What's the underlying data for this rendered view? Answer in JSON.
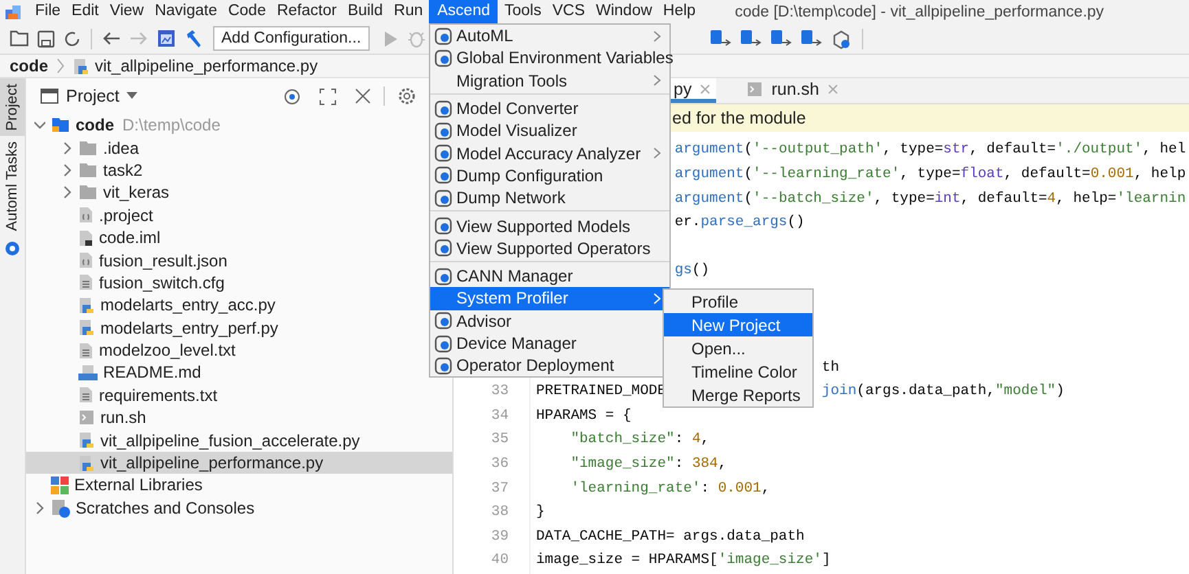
{
  "menubar": {
    "items": [
      {
        "label": "File",
        "selected": false
      },
      {
        "label": "Edit",
        "selected": false
      },
      {
        "label": "View",
        "selected": false
      },
      {
        "label": "Navigate",
        "selected": false
      },
      {
        "label": "Code",
        "selected": false
      },
      {
        "label": "Refactor",
        "selected": false
      },
      {
        "label": "Build",
        "selected": false
      },
      {
        "label": "Run",
        "selected": false
      },
      {
        "label": "Ascend",
        "selected": true
      },
      {
        "label": "Tools",
        "selected": false
      },
      {
        "label": "VCS",
        "selected": false
      },
      {
        "label": "Window",
        "selected": false
      },
      {
        "label": "Help",
        "selected": false
      }
    ]
  },
  "window_title": "code [D:\\temp\\code] - vit_allpipeline_performance.py",
  "toolbar": {
    "run_configuration": "Add Configuration..."
  },
  "breadcrumb": [
    "code",
    "vit_allpipeline_performance.py"
  ],
  "tool_strip": [
    {
      "label": "Project",
      "selected": true
    },
    {
      "label": "Automl Tasks",
      "selected": false
    }
  ],
  "project_panel": {
    "title": "Project",
    "tree": [
      {
        "name": "code",
        "path": "D:\\temp\\code",
        "kind": "module",
        "expanded": true,
        "selected": false,
        "children": [
          {
            "name": ".idea",
            "kind": "folder",
            "expanded": false,
            "selected": false
          },
          {
            "name": "task2",
            "kind": "folder",
            "expanded": false,
            "selected": false
          },
          {
            "name": "vit_keras",
            "kind": "folder",
            "expanded": false,
            "selected": false
          },
          {
            "name": ".project",
            "kind": "config",
            "selected": false
          },
          {
            "name": "code.iml",
            "kind": "iml",
            "selected": false
          },
          {
            "name": "fusion_result.json",
            "kind": "json",
            "selected": false
          },
          {
            "name": "fusion_switch.cfg",
            "kind": "text",
            "selected": false
          },
          {
            "name": "modelarts_entry_acc.py",
            "kind": "python",
            "selected": false
          },
          {
            "name": "modelarts_entry_perf.py",
            "kind": "python",
            "selected": false
          },
          {
            "name": "modelzoo_level.txt",
            "kind": "text",
            "selected": false
          },
          {
            "name": "README.md",
            "kind": "markdown",
            "selected": false
          },
          {
            "name": "requirements.txt",
            "kind": "text",
            "selected": false
          },
          {
            "name": "run.sh",
            "kind": "shell",
            "selected": false
          },
          {
            "name": "vit_allpipeline_fusion_accelerate.py",
            "kind": "python",
            "selected": false
          },
          {
            "name": "vit_allpipeline_performance.py",
            "kind": "python",
            "selected": true
          }
        ]
      },
      {
        "name": "External Libraries",
        "kind": "libraries",
        "selected": false
      },
      {
        "name": "Scratches and Consoles",
        "kind": "scratches",
        "expanded": false,
        "selected": false
      }
    ]
  },
  "editor": {
    "tabs": [
      {
        "label": "py",
        "kind": "python",
        "selected": true
      },
      {
        "label": "run.sh",
        "kind": "shell",
        "selected": false
      }
    ],
    "banner": "ed for the module",
    "lines": [
      {
        "pieces": [
          {
            "kind": "after_menu",
            "segments": [
              {
                "text": "argument",
                "kind": "func"
              },
              {
                "text": "(",
                "kind": "plain"
              },
              {
                "text": "'--output_path'",
                "kind": "string"
              },
              {
                "text": ", type=",
                "kind": "plain"
              },
              {
                "text": "str",
                "kind": "builtin"
              },
              {
                "text": ", default=",
                "kind": "plain"
              },
              {
                "text": "'./output'",
                "kind": "string"
              },
              {
                "text": ", hel",
                "kind": "plain"
              }
            ]
          }
        ]
      },
      {
        "pieces": [
          {
            "kind": "after_menu",
            "segments": [
              {
                "text": "argument",
                "kind": "func"
              },
              {
                "text": "(",
                "kind": "plain"
              },
              {
                "text": "'--learning_rate'",
                "kind": "string"
              },
              {
                "text": ", type=",
                "kind": "plain"
              },
              {
                "text": "float",
                "kind": "builtin"
              },
              {
                "text": ", default=",
                "kind": "plain"
              },
              {
                "text": "0.001",
                "kind": "number"
              },
              {
                "text": ", help",
                "kind": "plain"
              }
            ]
          }
        ]
      },
      {
        "pieces": [
          {
            "kind": "after_menu",
            "segments": [
              {
                "text": "argument",
                "kind": "func"
              },
              {
                "text": "(",
                "kind": "plain"
              },
              {
                "text": "'--batch_size'",
                "kind": "string"
              },
              {
                "text": ", type=",
                "kind": "plain"
              },
              {
                "text": "int",
                "kind": "builtin"
              },
              {
                "text": ", default=",
                "kind": "plain"
              },
              {
                "text": "4",
                "kind": "number"
              },
              {
                "text": ", help=",
                "kind": "plain"
              },
              {
                "text": "'learnin",
                "kind": "string"
              }
            ]
          }
        ]
      },
      {
        "pieces": [
          {
            "kind": "after_menu",
            "segments": [
              {
                "text": "er.",
                "kind": "plain"
              },
              {
                "text": "parse_args",
                "kind": "func"
              },
              {
                "text": "()",
                "kind": "plain"
              }
            ]
          }
        ]
      },
      {
        "kind": "blank"
      },
      {
        "pieces": [
          {
            "kind": "after_menu",
            "segments": [
              {
                "text": "gs",
                "kind": "func"
              },
              {
                "text": "()",
                "kind": "plain"
              }
            ]
          }
        ]
      },
      {
        "kind": "blank"
      },
      {
        "kind": "blank"
      },
      {
        "kind": "blank"
      },
      {
        "pieces": [
          {
            "kind": "after_submenu",
            "segments": [
              {
                "text": "th",
                "kind": "plain"
              }
            ]
          }
        ]
      },
      {
        "number": "33",
        "pieces": [
          {
            "kind": "start",
            "segments": [
              {
                "text": "PRETRAINED_MODE",
                "kind": "plain"
              }
            ]
          },
          {
            "kind": "after_submenu",
            "segments": [
              {
                "text": "join",
                "kind": "func"
              },
              {
                "text": "(args.data_path,",
                "kind": "plain"
              },
              {
                "text": "\"model\"",
                "kind": "string"
              },
              {
                "text": ")",
                "kind": "plain"
              }
            ]
          }
        ]
      },
      {
        "number": "34",
        "pieces": [
          {
            "kind": "start",
            "segments": [
              {
                "text": "HPARAMS = {",
                "kind": "plain"
              }
            ]
          }
        ]
      },
      {
        "number": "35",
        "pieces": [
          {
            "kind": "indent",
            "segments": [
              {
                "text": "\"batch_size\"",
                "kind": "string"
              },
              {
                "text": ": ",
                "kind": "plain"
              },
              {
                "text": "4",
                "kind": "number"
              },
              {
                "text": ",",
                "kind": "plain"
              }
            ]
          }
        ]
      },
      {
        "number": "36",
        "pieces": [
          {
            "kind": "indent",
            "segments": [
              {
                "text": "\"image_size\"",
                "kind": "string"
              },
              {
                "text": ": ",
                "kind": "plain"
              },
              {
                "text": "384",
                "kind": "number"
              },
              {
                "text": ",",
                "kind": "plain"
              }
            ]
          }
        ]
      },
      {
        "number": "37",
        "pieces": [
          {
            "kind": "indent",
            "segments": [
              {
                "text": "'learning_rate'",
                "kind": "string"
              },
              {
                "text": ": ",
                "kind": "plain"
              },
              {
                "text": "0.001",
                "kind": "number"
              },
              {
                "text": ",",
                "kind": "plain"
              }
            ]
          }
        ]
      },
      {
        "number": "38",
        "pieces": [
          {
            "kind": "start",
            "segments": [
              {
                "text": "}",
                "kind": "plain"
              }
            ]
          }
        ]
      },
      {
        "number": "39",
        "pieces": [
          {
            "kind": "start",
            "segments": [
              {
                "text": "DATA_CACHE_PATH= args.data_path",
                "kind": "plain"
              }
            ]
          }
        ]
      },
      {
        "number": "40",
        "pieces": [
          {
            "kind": "start",
            "segments": [
              {
                "text": "image_size = HPARAMS[",
                "kind": "plain"
              },
              {
                "text": "'image_size'",
                "kind": "string"
              },
              {
                "text": "]",
                "kind": "plain"
              }
            ]
          }
        ]
      }
    ]
  },
  "ascend_menu": {
    "items": [
      {
        "label": "AutoML",
        "has_icon": true,
        "submenu": true,
        "selected": false
      },
      {
        "label": "Global Environment Variables",
        "has_icon": true,
        "selected": false
      },
      {
        "label": "Migration Tools",
        "submenu": true,
        "selected": false
      },
      {
        "label": "Model Converter",
        "has_icon": true,
        "separator_before": true,
        "selected": false
      },
      {
        "label": "Model Visualizer",
        "has_icon": true,
        "selected": false
      },
      {
        "label": "Model Accuracy Analyzer",
        "has_icon": true,
        "submenu": true,
        "selected": false
      },
      {
        "label": "Dump Configuration",
        "has_icon": true,
        "selected": false
      },
      {
        "label": "Dump Network",
        "has_icon": true,
        "selected": false
      },
      {
        "label": "View Supported Models",
        "has_icon": true,
        "separator_before": true,
        "selected": false
      },
      {
        "label": "View Supported Operators",
        "has_icon": true,
        "selected": false
      },
      {
        "label": "CANN Manager",
        "has_icon": true,
        "separator_before": true,
        "selected": false
      },
      {
        "label": "System Profiler",
        "submenu": true,
        "selected": true
      },
      {
        "label": "Advisor",
        "has_icon": true,
        "selected": false
      },
      {
        "label": "Device Manager",
        "has_icon": true,
        "selected": false
      },
      {
        "label": "Operator Deployment",
        "has_icon": true,
        "selected": false
      }
    ]
  },
  "system_profiler_menu": {
    "items": [
      {
        "label": "Profile",
        "selected": false
      },
      {
        "label": "New Project",
        "selected": true
      },
      {
        "label": "Open...",
        "selected": false
      },
      {
        "label": "Timeline Color",
        "selected": false
      },
      {
        "label": "Merge Reports",
        "selected": false
      }
    ]
  }
}
